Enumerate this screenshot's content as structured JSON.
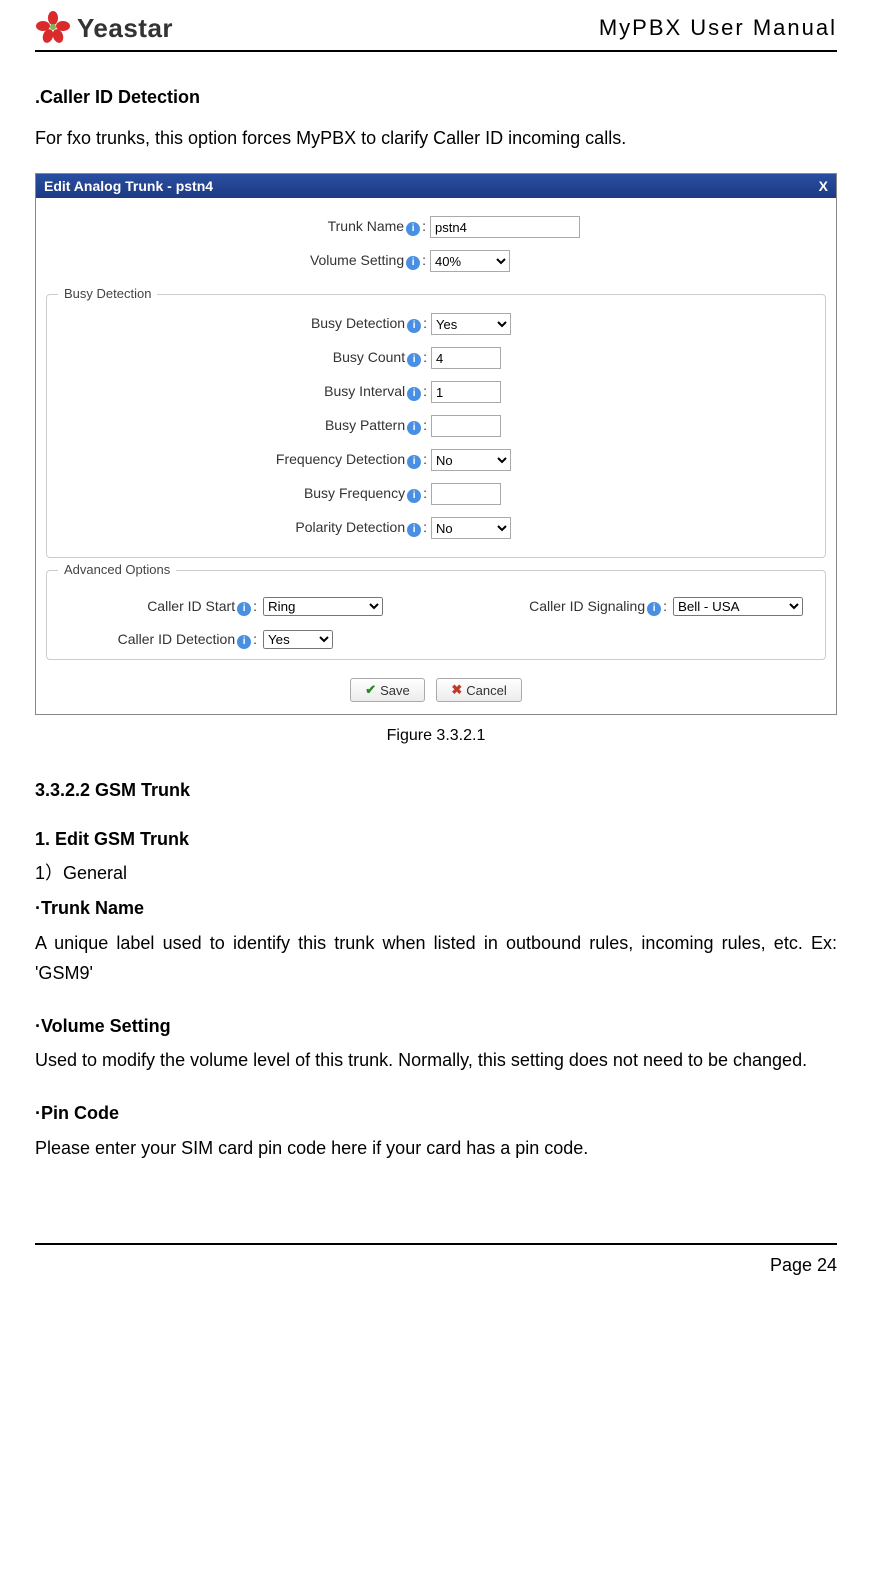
{
  "header": {
    "brand": "Yeastar",
    "manual_title": "MyPBX User Manual"
  },
  "intro": {
    "heading": ".Caller ID Detection",
    "text": "For fxo trunks, this option forces MyPBX to clarify Caller ID incoming calls."
  },
  "dialog": {
    "title": "Edit Analog Trunk - pstn4",
    "close": "X",
    "top_fields": {
      "trunk_name_label": "Trunk Name",
      "trunk_name_value": "pstn4",
      "volume_label": "Volume Setting",
      "volume_value": "40%"
    },
    "busy": {
      "legend": "Busy Detection",
      "detection_label": "Busy Detection",
      "detection_value": "Yes",
      "count_label": "Busy Count",
      "count_value": "4",
      "interval_label": "Busy Interval",
      "interval_value": "1",
      "pattern_label": "Busy Pattern",
      "pattern_value": "",
      "freq_detect_label": "Frequency Detection",
      "freq_detect_value": "No",
      "busy_freq_label": "Busy Frequency",
      "busy_freq_value": "",
      "polarity_label": "Polarity Detection",
      "polarity_value": "No"
    },
    "advanced": {
      "legend": "Advanced Options",
      "cid_start_label": "Caller ID Start",
      "cid_start_value": "Ring",
      "cid_signaling_label": "Caller ID Signaling",
      "cid_signaling_value": "Bell - USA",
      "cid_detection_label": "Caller ID Detection",
      "cid_detection_value": "Yes"
    },
    "buttons": {
      "save": "Save",
      "cancel": "Cancel"
    }
  },
  "figure_caption": "Figure 3.3.2.1",
  "sections": {
    "s1": "3.3.2.2 GSM Trunk",
    "s2": "1. Edit GSM Trunk",
    "s3": "1）General",
    "trunk_name_h": "·Trunk Name",
    "trunk_name_p": "A unique label used to identify this trunk when listed in outbound rules, incoming rules, etc. Ex: 'GSM9'",
    "volume_h": "·Volume Setting",
    "volume_p": "Used to modify the volume level of this trunk. Normally, this setting does not need to be changed.",
    "pin_h": "·Pin Code",
    "pin_p": "Please enter your SIM card pin code here if your card has a pin code."
  },
  "footer": {
    "page": "Page 24"
  }
}
